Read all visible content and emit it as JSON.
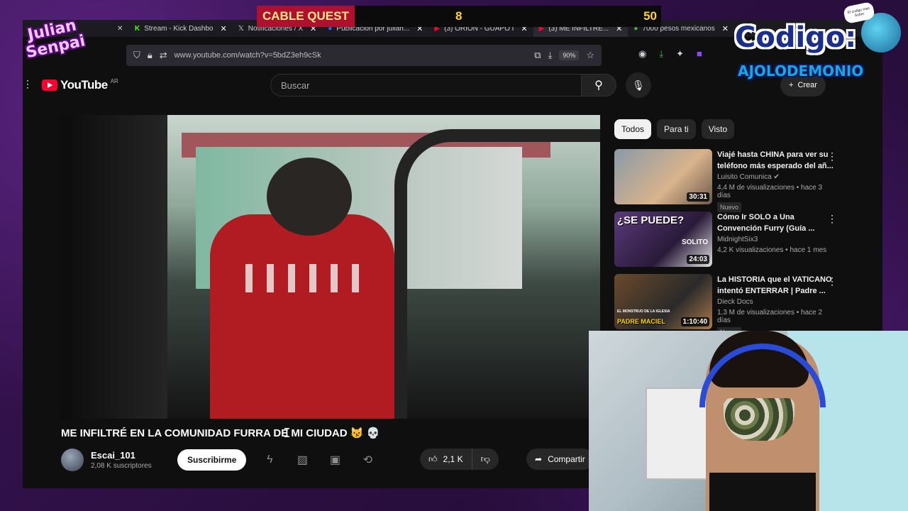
{
  "overlay": {
    "left_logo_line1": "Julian",
    "left_logo_line2": "Senpai",
    "right_logo_line1": "Codigo:",
    "right_logo_line2": "AJOLODEMONIO",
    "mascot_speech": "El codigo mas Sober"
  },
  "scoreboard": {
    "title": "CABLE QUEST",
    "left_score": "8",
    "right_score": "50",
    "accent": "#ffd23d"
  },
  "tabs": [
    {
      "icon": "kick-icon",
      "label": "Stream - Kick Dashbo"
    },
    {
      "icon": "x-icon",
      "label": "Notificaciones / X"
    },
    {
      "icon": "facebook-icon",
      "label": "Publicación por julian..."
    },
    {
      "icon": "youtube-icon",
      "label": "(3) ORION - GUAPO I"
    },
    {
      "icon": "youtube-icon",
      "label": "(3) ME INFILTRÉ..."
    },
    {
      "icon": "currency-icon",
      "label": "7000 pesos mexicanos"
    }
  ],
  "browser": {
    "url": "www.youtube.com/watch?v=5bdZ3eh9cSk",
    "zoom": "90%"
  },
  "youtube": {
    "logo_text": "YouTube",
    "country": "AR",
    "search_placeholder": "Buscar",
    "create_label": "Crear"
  },
  "video": {
    "title": "ME INFILTRÉ EN LA COMUNIDAD FURRA DE MI CIUDAD 😼 💀",
    "channel": "Escai_101",
    "subscribers": "2,08 K suscriptores",
    "subscribe_label": "Suscribirme",
    "likes": "2,1 K",
    "share_label": "Compartir"
  },
  "chips": [
    "Todos",
    "Para ti",
    "Visto"
  ],
  "recommendations": [
    {
      "title": "Viajé hasta CHINA para ver su teléfono más esperado del añ...",
      "channel": "Luisito Comunica",
      "meta": "4,4 M de visualizaciones • hace 3 días",
      "badge": "Nuevo",
      "duration": "30:31",
      "caption": ""
    },
    {
      "title": "Cómo Ir SOLO a Una Convención Furry (Guía ...",
      "channel": "MidnightSix3",
      "meta": "4,2 K visualizaciones • hace 1 mes",
      "badge": "",
      "duration": "24:03",
      "caption": "¿SE PUEDE?",
      "caption_extra": "SOLITO"
    },
    {
      "title": "La HISTORIA que el VATICANO intentó ENTERRAR | Padre ...",
      "channel": "Dieck Docs",
      "meta": "1,3 M de visualizaciones • hace 2 días",
      "badge": "Nuevo",
      "duration": "1:10:40",
      "caption": "PADRE MACIEL",
      "caption_small": "EL MONSTRUO DE LA IGLESIA"
    }
  ]
}
